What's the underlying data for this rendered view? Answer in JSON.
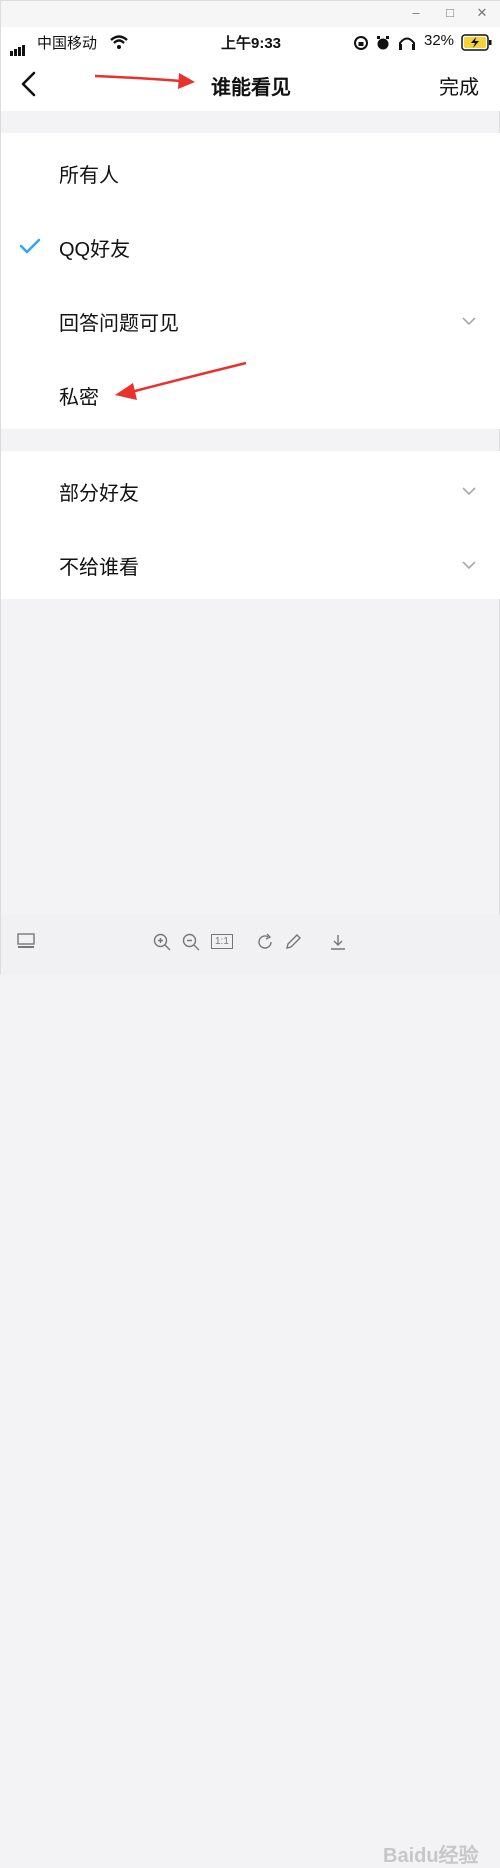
{
  "window": {
    "minimize": "–",
    "maximize": "□",
    "close": "✕"
  },
  "status_bar": {
    "carrier": "中国移动",
    "time": "上午9:33",
    "battery_percent": "32%"
  },
  "nav": {
    "back_icon": "chevron-left-icon",
    "title": "谁能看见",
    "done_label": "完成"
  },
  "options_group_1": [
    {
      "label": "所有人",
      "checked": false,
      "expandable": false
    },
    {
      "label": "QQ好友",
      "checked": true,
      "expandable": false
    },
    {
      "label": "回答问题可见",
      "checked": false,
      "expandable": true
    },
    {
      "label": "私密",
      "checked": false,
      "expandable": false
    }
  ],
  "options_group_2": [
    {
      "label": "部分好友",
      "checked": false,
      "expandable": true
    },
    {
      "label": "不给谁看",
      "checked": false,
      "expandable": true
    }
  ],
  "check_color": "#31a6f7",
  "annotation_color": "#e8322b",
  "toolbar": {
    "page_indicator": "1:1",
    "watermark": "Baidu经验"
  }
}
